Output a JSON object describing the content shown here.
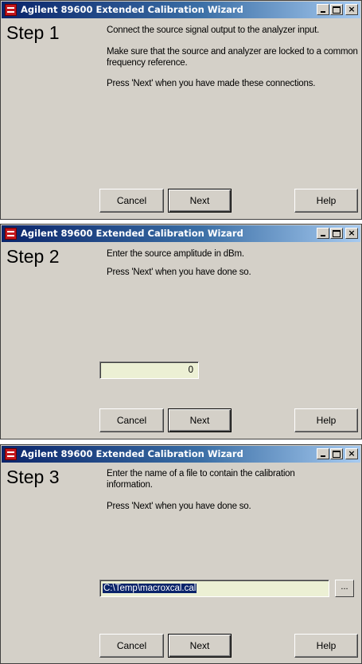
{
  "colors": {
    "window_bg": "#d4d0c8",
    "titlebar_start": "#0a246a",
    "titlebar_end": "#a6caf0",
    "input_bg": "#ecf0d4",
    "selection_bg": "#0a246a"
  },
  "window_title": "Agilent 89600 Extended Calibration Wizard",
  "icons": {
    "app": "agilent-vsa-icon",
    "minimize": "minimize-icon",
    "maximize": "maximize-icon",
    "close": "close-icon"
  },
  "close_glyph": "×",
  "buttons": {
    "cancel": "Cancel",
    "next": "Next",
    "help": "Help",
    "browse": "..."
  },
  "steps": [
    {
      "label": "Step 1",
      "lines": [
        "Connect the source signal output to the analyzer input.",
        "Make sure that the source and analyzer are locked to a common frequency reference.",
        "Press 'Next' when you have made these connections."
      ]
    },
    {
      "label": "Step 2",
      "lines": [
        "Enter the source amplitude in dBm.",
        "Press 'Next' when you have done so."
      ],
      "input_value": "0"
    },
    {
      "label": "Step 3",
      "lines": [
        "Enter the name of a file to contain the calibration information.",
        "Press 'Next' when you have done so."
      ],
      "input_value": "C:\\Temp\\macroxcal.cal"
    }
  ]
}
